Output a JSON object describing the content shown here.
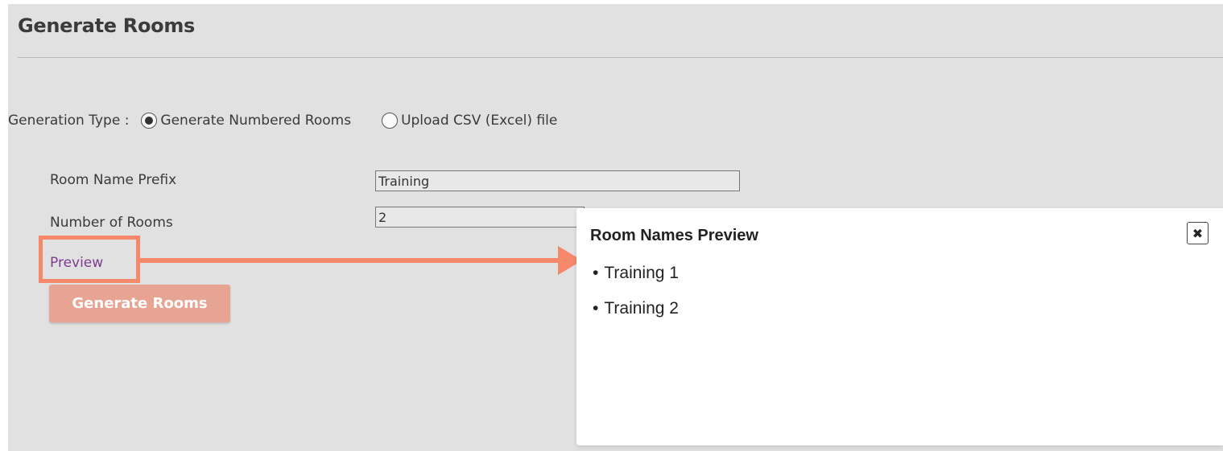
{
  "page": {
    "title": "Generate Rooms"
  },
  "generation_type": {
    "label": "Generation Type :",
    "options": [
      {
        "label": "Generate Numbered Rooms",
        "selected": true
      },
      {
        "label": "Upload CSV (Excel) file",
        "selected": false
      }
    ]
  },
  "form": {
    "room_name_prefix": {
      "label": "Room Name Prefix",
      "value": "Training"
    },
    "number_of_rooms": {
      "label": "Number of Rooms",
      "value": "2"
    },
    "preview_link": "Preview",
    "generate_button": "Generate Rooms"
  },
  "modal": {
    "title": "Room Names Preview",
    "close_icon": "close-icon",
    "items": [
      "Training 1",
      "Training 2"
    ],
    "bullet": "•"
  },
  "colors": {
    "background": "#e1e1e1",
    "highlight": "#f5876a",
    "button": "#e8a493",
    "link": "#7e3c8e"
  }
}
